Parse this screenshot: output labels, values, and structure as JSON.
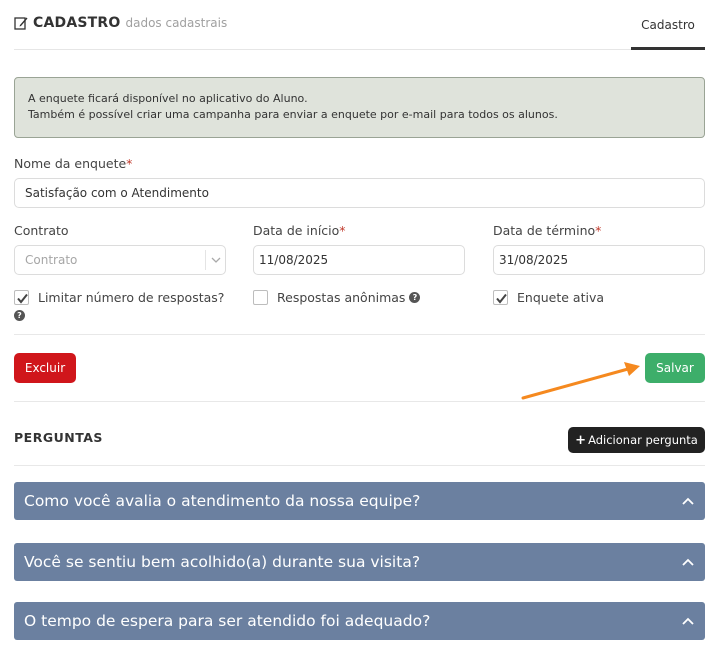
{
  "header": {
    "title": "CADASTRO",
    "subtitle": "dados cadastrais",
    "tab": "Cadastro"
  },
  "info": {
    "line1": "A enquete ficará disponível no aplicativo do Aluno.",
    "line2": "Também é possível criar uma campanha para enviar a enquete por e-mail para todos os alunos."
  },
  "form": {
    "name_label": "Nome da enquete",
    "name_value": "Satisfação com o Atendimento",
    "contract_label": "Contrato",
    "contract_value": "Contrato",
    "start_label": "Data de início",
    "start_value": "11/08/2025",
    "end_label": "Data de término",
    "end_value": "31/08/2025",
    "required_mark": "*",
    "limit_label": "Limitar número de respostas?",
    "anon_label": "Respostas anônimas",
    "active_label": "Enquete ativa",
    "limit_checked": true,
    "anon_checked": false,
    "active_checked": true
  },
  "actions": {
    "delete": "Excluir",
    "save": "Salvar"
  },
  "questions": {
    "title": "PERGUNTAS",
    "add": "Adicionar pergunta",
    "items": [
      "Como você avalia o atendimento da nossa equipe?",
      "Você se sentiu bem acolhido(a) durante sua visita?",
      "O tempo de espera para ser atendido foi adequado?"
    ]
  },
  "colors": {
    "danger": "#d0161b",
    "success": "#3dae6a",
    "accordion": "#6b80a0",
    "annotation_arrow": "#f5891f"
  },
  "icons": [
    "edit-icon",
    "help-icon",
    "chevron-down-icon",
    "plus-icon",
    "chevron-up-icon",
    "check-icon"
  ]
}
